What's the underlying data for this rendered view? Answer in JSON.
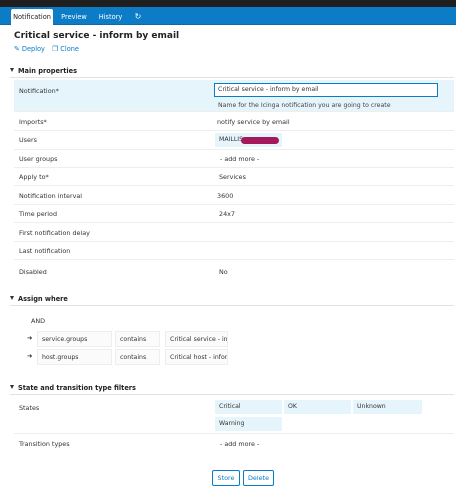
{
  "tabs": [
    {
      "label": "Notification"
    },
    {
      "label": "Preview"
    },
    {
      "label": "History"
    }
  ],
  "refresh_icon": "refresh-icon",
  "page_title": "Critical service - inform by email",
  "actions": {
    "deploy": "Deploy",
    "clone": "Clone"
  },
  "sections": {
    "main": "Main properties",
    "assign": "Assign where",
    "state": "State and transition type filters"
  },
  "fields": {
    "notification": {
      "label": "Notification*",
      "value": "Critical service - inform by email",
      "hint": "Name for the Icinga notification you are going to create"
    },
    "imports": {
      "label": "Imports*",
      "value": "notify service by email"
    },
    "users": {
      "label": "Users",
      "value": "MAILLIS"
    },
    "user_groups": {
      "label": "User groups",
      "value": "- add more -"
    },
    "apply_to": {
      "label": "Apply to*",
      "value": "Services"
    },
    "interval": {
      "label": "Notification interval",
      "value": "3600"
    },
    "time_period": {
      "label": "Time period",
      "value": "24x7"
    },
    "first_delay": {
      "label": "First notification delay",
      "value": ""
    },
    "last_notification": {
      "label": "Last notification",
      "value": ""
    },
    "disabled": {
      "label": "Disabled",
      "value": "No"
    }
  },
  "assign": {
    "operator": "AND",
    "conditions": [
      {
        "field": "service.groups",
        "op": "contains",
        "value": "Critical service - infor"
      },
      {
        "field": "host.groups",
        "op": "contains",
        "value": "Critical host - inform"
      }
    ]
  },
  "states": {
    "label": "States",
    "items": [
      "Critical",
      "OK",
      "Unknown",
      "Warning"
    ]
  },
  "transition_types": {
    "label": "Transition types",
    "value": "- add more -"
  },
  "buttons": {
    "store": "Store",
    "delete": "Delete"
  },
  "colors": {
    "accent": "#0b7cc5",
    "highlight": "#e6f5fc",
    "redaction": "#a3195b"
  }
}
